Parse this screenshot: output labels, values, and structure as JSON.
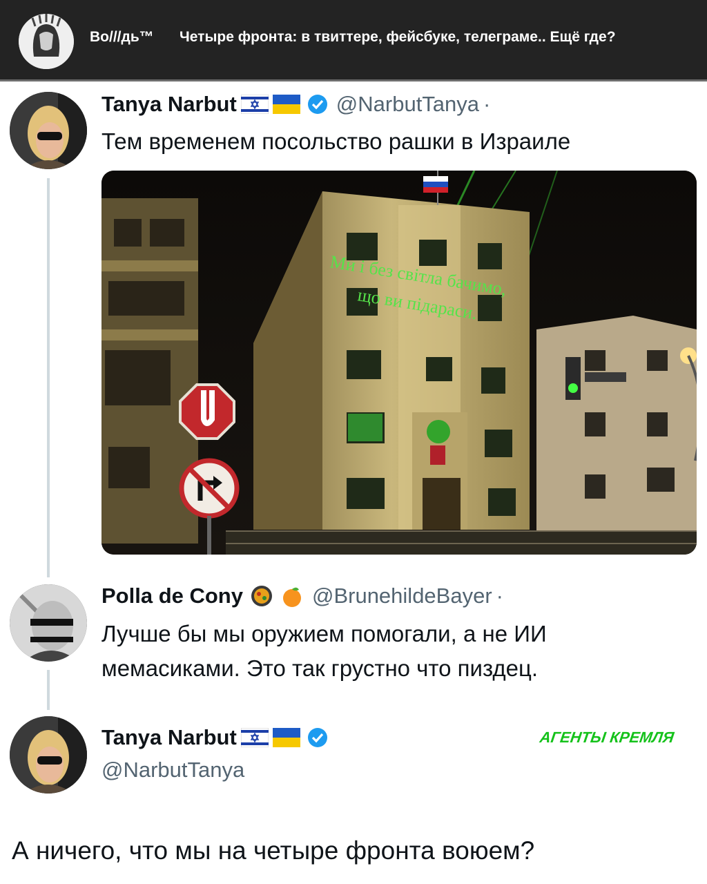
{
  "header": {
    "channel_name": "Во///дь™",
    "title": "Четыре фронта: в твиттере, фейсбуке, телеграме.. Ещё где?"
  },
  "tweet1": {
    "name": "Tanya Narbut",
    "handle": "@NarbutTanya",
    "dot": "·",
    "text": "Тем временем посольство рашки в Израиле",
    "flags": [
      "israel-flag",
      "ukraine-flag"
    ],
    "verified": true
  },
  "photo": {
    "projection_line1": "Ми і без світла бачимо,",
    "projection_line2": "що ви підараси."
  },
  "tweet2": {
    "name": "Polla de Cony",
    "handle": "@BrunehildeBayer",
    "dot": "·",
    "emojis": [
      "paella-icon",
      "orange-icon"
    ],
    "line1": "Лучше бы мы оружием помогали, а не ИИ",
    "line2": "мемасиками. Это так грустно что пиздец."
  },
  "tweet3": {
    "name": "Tanya Narbut",
    "handle": "@NarbutTanya",
    "flags": [
      "israel-flag",
      "ukraine-flag"
    ],
    "verified": true
  },
  "stamp": "АГЕНТЫ КРЕМЛЯ",
  "bottom_text": "А ничего, что мы на четыре фронта воюем?",
  "colors": {
    "header_bg": "#232323",
    "verified_blue": "#1d9bf0",
    "laser_green": "#56e34a",
    "stamp_green": "#15c21b"
  }
}
